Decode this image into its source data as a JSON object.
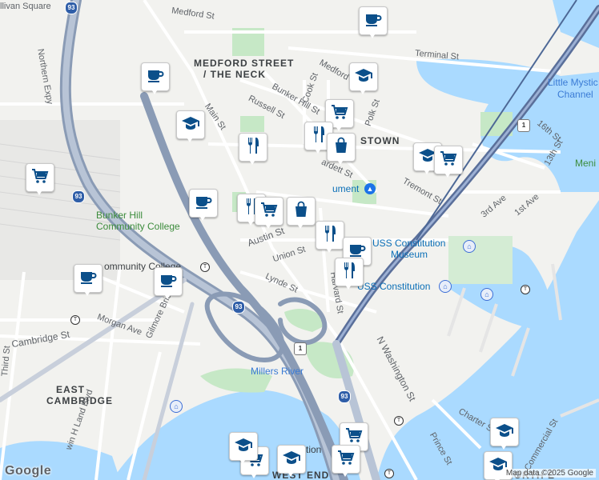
{
  "map": {
    "attribution": "Map data ©2025 Google",
    "logo": "Google",
    "colors": {
      "water": "#aadaff",
      "land": "#f2f2ef",
      "park": "#c6e8c6",
      "highway": "#8a9bb5",
      "pin_icon": "#0b4f8a"
    },
    "labels": {
      "sullivan_sq": "llivan Square",
      "medford_st_top": "Medford St",
      "medford_neck_1": "MEDFORD STREET",
      "medford_neck_2": "/ THE NECK",
      "northern_expy": "Northern Expy",
      "main_st": "Main St",
      "terminal_st": "Terminal St",
      "little_mystic_1": "Little Mystic",
      "little_mystic_2": "Channel",
      "bunker_hill_st": "Bunker Hill St",
      "cook_st": "Cook St",
      "russell_st": "Russell St",
      "medford_st_2": "Medford St",
      "polk_st": "Polk St",
      "town": "STOWN",
      "sixteenth_st": "16th St",
      "thirteenth_st": "13th St",
      "meni": "Meni",
      "bunker_hill_cc_1": "Bunker Hill",
      "bunker_hill_cc_2": "Community College",
      "monument": "Bunker Hill Monument",
      "monument_short": "ument",
      "tremont_st": "Tremont St",
      "third_ave": "3rd Ave",
      "first_ave": "1st Ave",
      "bardett_st": "ardett St",
      "austin_st": "Austin St",
      "uss_museum_1": "USS Constitution",
      "uss_museum_2": "Museum",
      "community_college_station": "ommunity College",
      "union_st": "Union St",
      "lynde_st": "Lynde St",
      "harvard_st": "Harvard St",
      "uss_constitution": "USS Constitution",
      "morgan_ave": "Morgan Ave",
      "cambridge_st": "Cambridge St",
      "gilmore_bridge": "Gilmore Bridge",
      "third_st": "Third St",
      "n_washington_st": "N Washington St",
      "millers_river": "Millers River",
      "east_cambridge_1": "EAST",
      "east_cambridge_2": "CAMBRIDGE",
      "land_blvd": "win H Land Blvd",
      "charter_st": "Charter St",
      "commercial_st": "Commercial St",
      "prince_st": "Prince St",
      "north_end": "NORTH E",
      "west_end": "WEST END",
      "n_station": "N Station",
      "route_93": "93",
      "route_1": "1"
    },
    "pins": [
      {
        "name": "cafe",
        "icon": "coffee-icon"
      },
      {
        "name": "cafe",
        "icon": "coffee-icon"
      },
      {
        "name": "school",
        "icon": "school-icon"
      },
      {
        "name": "school",
        "icon": "school-icon"
      },
      {
        "name": "grocery",
        "icon": "cart-icon"
      },
      {
        "name": "grocery",
        "icon": "cart-icon"
      },
      {
        "name": "restaurant",
        "icon": "fork-knife-icon"
      },
      {
        "name": "shop",
        "icon": "bag-icon"
      },
      {
        "name": "school",
        "icon": "school-icon"
      },
      {
        "name": "grocery",
        "icon": "cart-icon"
      },
      {
        "name": "restaurant",
        "icon": "fork-knife-icon"
      },
      {
        "name": "cafe",
        "icon": "coffee-icon"
      },
      {
        "name": "restaurant",
        "icon": "fork-knife-icon"
      },
      {
        "name": "grocery",
        "icon": "cart-icon"
      },
      {
        "name": "shop",
        "icon": "bag-icon"
      },
      {
        "name": "restaurant",
        "icon": "fork-knife-icon"
      },
      {
        "name": "cafe",
        "icon": "coffee-icon"
      },
      {
        "name": "restaurant",
        "icon": "fork-knife-icon"
      },
      {
        "name": "cafe",
        "icon": "coffee-icon"
      },
      {
        "name": "cafe",
        "icon": "coffee-icon"
      },
      {
        "name": "school",
        "icon": "school-icon"
      },
      {
        "name": "grocery",
        "icon": "cart-icon"
      },
      {
        "name": "grocery",
        "icon": "cart-icon"
      },
      {
        "name": "school",
        "icon": "school-icon"
      },
      {
        "name": "grocery",
        "icon": "cart-icon"
      },
      {
        "name": "school",
        "icon": "school-icon"
      },
      {
        "name": "school",
        "icon": "school-icon"
      }
    ]
  }
}
